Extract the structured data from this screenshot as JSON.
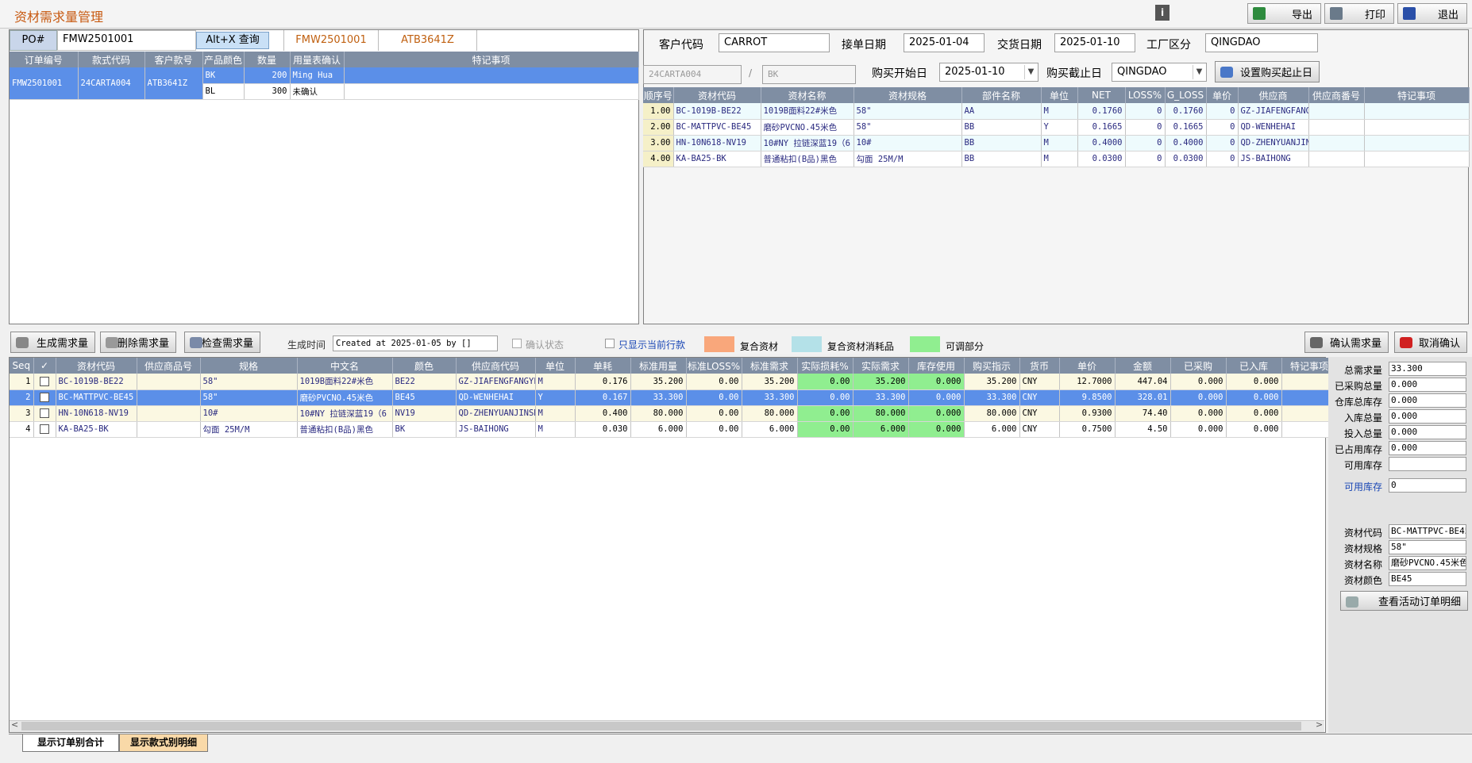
{
  "app": {
    "title": "资材需求量管理",
    "info_icon": "i",
    "export_label": "导出",
    "print_label": "打印",
    "exit_label": "退出"
  },
  "po": {
    "label": "PO#",
    "value": "FMW2501001",
    "query_label": "Alt+X 查询",
    "info1": "FMW2501001",
    "info2": "ATB3641Z"
  },
  "orders": {
    "headers": [
      "订单编号",
      "款式代码",
      "客户款号",
      "产品颜色",
      "数量",
      "用量表确认",
      "特记事项"
    ],
    "order_no": "FMW2501001",
    "style_code": "24CARTA004",
    "cust_style": "ATB3641Z",
    "rows": [
      {
        "color": "BK",
        "qty": "200",
        "confirm": "Ming Hua",
        "note": ""
      },
      {
        "color": "BL",
        "qty": "300",
        "confirm": "未确认",
        "note": ""
      }
    ]
  },
  "form": {
    "cust_code_label": "客户代码",
    "cust_code": "CARROT",
    "order_date_label": "接单日期",
    "order_date": "2025-01-04",
    "delivery_label": "交货日期",
    "delivery_date": "2025-01-10",
    "factory_label": "工厂区分",
    "factory": "QINGDAO",
    "style_disp": "24CARTA004",
    "slash": "/",
    "color_disp": "BK",
    "buy_start_label": "购买开始日",
    "buy_start": "2025-01-10",
    "buy_end_label": "购买截止日",
    "buy_end": "QINGDAO",
    "set_btn": "设置购买起止日"
  },
  "bom": {
    "headers": [
      "顺序号",
      "资材代码",
      "资材名称",
      "资材规格",
      "部件名称",
      "单位",
      "NET",
      "LOSS%",
      "G_LOSS",
      "单价",
      "供应商",
      "供应商番号",
      "特记事项"
    ],
    "rows": [
      [
        "1.00",
        "BC-1019B-BE22",
        "1019B面料22#米色",
        "58\"",
        "AA",
        "M",
        "0.1760",
        "0",
        "0.1760",
        "0",
        "GZ-JIAFENGFANG",
        "",
        ""
      ],
      [
        "2.00",
        "BC-MATTPVC-BE45",
        "磨砂PVCNO.45米色",
        "58\"",
        "BB",
        "Y",
        "0.1665",
        "0",
        "0.1665",
        "0",
        "QD-WENHEHAI",
        "",
        ""
      ],
      [
        "3.00",
        "HN-10N618-NV19",
        "10#NY 拉链深蓝19（6",
        "10#",
        "BB",
        "M",
        "0.4000",
        "0",
        "0.4000",
        "0",
        "QD-ZHENYUANJIN",
        "",
        ""
      ],
      [
        "4.00",
        "KA-BA25-BK",
        "普通粘扣(B品)黑色",
        "勾面  25M/M",
        "BB",
        "M",
        "0.0300",
        "0",
        "0.0300",
        "0",
        "JS-BAIHONG",
        "",
        ""
      ]
    ]
  },
  "toolbar": {
    "gen_label": "生成需求量",
    "del_label": "删除需求量",
    "check_label": "检查需求量",
    "gen_time_label": "生成时间",
    "gen_time": "Created at 2025-01-05 by []",
    "confirm_status": "确认状态",
    "only_current": "只显示当前行款",
    "legend1": "复合资材",
    "legend2": "复合资材消耗品",
    "legend3": "可调部分",
    "confirm_btn": "确认需求量",
    "cancel_btn": "取消确认"
  },
  "colors": {
    "legend1": "#f9a77b",
    "legend2": "#b4e1e8",
    "legend3": "#90ee90",
    "header": "#7f8ea3",
    "selected": "#5b8fe8"
  },
  "req": {
    "headers": [
      "Seq",
      "✓",
      "资材代码",
      "供应商品号",
      "规格",
      "中文名",
      "颜色",
      "供应商代码",
      "单位",
      "单耗",
      "标准用量",
      "标准LOSS%",
      "标准需求",
      "实际损耗%",
      "实际需求",
      "库存使用",
      "购买指示",
      "货币",
      "单价",
      "金额",
      "已采购",
      "已入库",
      "特记事项"
    ],
    "rows": [
      [
        "1",
        "",
        "BC-1019B-BE22",
        "",
        "58\"",
        "1019B面料22#米色",
        "BE22",
        "GZ-JIAFENGFANGYE",
        "M",
        "0.176",
        "35.200",
        "0.00",
        "35.200",
        "0.00",
        "35.200",
        "0.000",
        "35.200",
        "CNY",
        "12.7000",
        "447.04",
        "0.000",
        "0.000",
        ""
      ],
      [
        "2",
        "✓",
        "BC-MATTPVC-BE45",
        "",
        "58\"",
        "磨砂PVCNO.45米色",
        "BE45",
        "QD-WENHEHAI",
        "Y",
        "0.167",
        "33.300",
        "0.00",
        "33.300",
        "0.00",
        "33.300",
        "0.000",
        "33.300",
        "CNY",
        "9.8500",
        "328.01",
        "0.000",
        "0.000",
        ""
      ],
      [
        "3",
        "",
        "HN-10N618-NV19",
        "",
        "10#",
        "10#NY 拉链深蓝19（6",
        "NV19",
        "QD-ZHENYUANJINSH",
        "M",
        "0.400",
        "80.000",
        "0.00",
        "80.000",
        "0.00",
        "80.000",
        "0.000",
        "80.000",
        "CNY",
        "0.9300",
        "74.40",
        "0.000",
        "0.000",
        ""
      ],
      [
        "4",
        "",
        "KA-BA25-BK",
        "",
        "勾面  25M/M",
        "普通粘扣(B品)黑色",
        "BK",
        "JS-BAIHONG",
        "M",
        "0.030",
        "6.000",
        "0.00",
        "6.000",
        "0.00",
        "6.000",
        "0.000",
        "6.000",
        "CNY",
        "0.7500",
        "4.50",
        "0.000",
        "0.000",
        ""
      ]
    ]
  },
  "side": {
    "total_req_label": "总需求量",
    "total_req": "33.300",
    "purchased_label": "已采购总量",
    "purchased": "0.000",
    "stock_label": "仓库总库存",
    "stock": "0.000",
    "in_label": "入库总量",
    "in_total": "0.000",
    "input_label": "投入总量",
    "input_total": "0.000",
    "occupied_label": "已占用库存",
    "occupied": "0.000",
    "available_label": "可用库存",
    "available": "",
    "avail2_label": "可用库存",
    "avail2": "0",
    "mat_code_label": "资材代码",
    "mat_code": "BC-MATTPVC-BE45",
    "mat_spec_label": "资材规格",
    "mat_spec": "58\"",
    "mat_name_label": "资材名称",
    "mat_name": "磨砂PVCNO.45米色",
    "mat_color_label": "资材颜色",
    "mat_color": "BE45",
    "view_btn": "查看活动订单明细"
  },
  "tabs": {
    "tab1": "显示订单别合计",
    "tab2": "显示款式别明细"
  }
}
